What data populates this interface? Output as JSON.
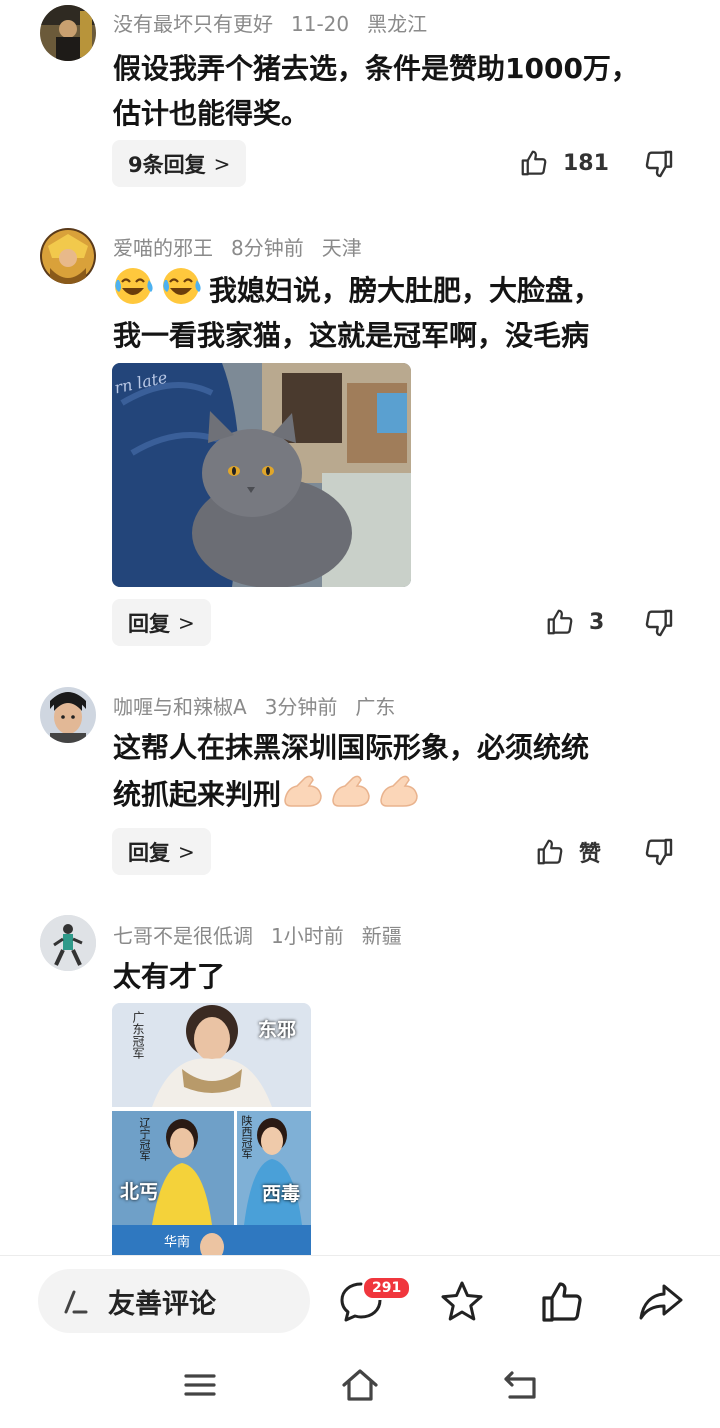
{
  "comments": [
    {
      "user": "没有最坏只有更好",
      "time": "11-20",
      "location": "黑龙江",
      "text_line1": "假设我弄个猪去选，条件是赞助1000万，",
      "text_line2": "估计也能得奖。",
      "reply_label": "9条回复",
      "likes": "181"
    },
    {
      "user": "爱喵的邪王",
      "time": "8分钟前",
      "location": "天津",
      "text_line1": "我媳妇说，膀大肚肥，大脸盘，",
      "text_line2": "我一看我家猫，这就是冠军啊，没毛病",
      "image_text": "rn late",
      "reply_label": "回复",
      "likes": "3"
    },
    {
      "user": "咖喱与和辣椒A",
      "time": "3分钟前",
      "location": "广东",
      "text_line1": "这帮人在抹黑深圳国际形象，必须统统",
      "text_line2": "统抓起来判刑",
      "reply_label": "回复",
      "likes": "赞"
    },
    {
      "user": "七哥不是很低调",
      "time": "1小时前",
      "location": "新疆",
      "text_line1": "太有才了",
      "image_labels": [
        "广东冠军",
        "东邪",
        "辽宁冠军",
        "陕西冠军",
        "北丐",
        "西毒",
        "华南"
      ]
    }
  ],
  "bottom_bar": {
    "compose_label": "友善评论",
    "comment_count": "291"
  },
  "colors": {
    "badge": "#f0363d",
    "meta": "#8a8a8a"
  }
}
